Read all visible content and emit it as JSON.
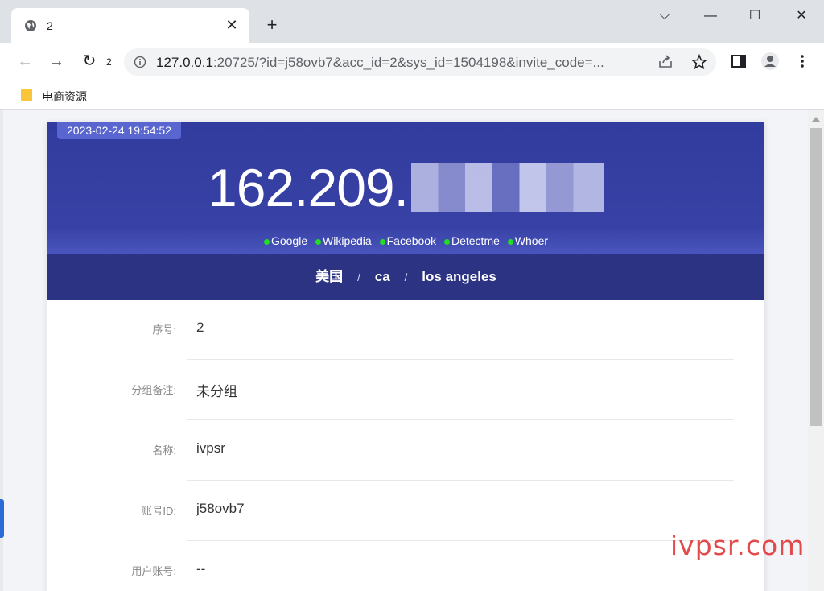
{
  "browser": {
    "tab_title": "2",
    "reload_count": "2",
    "url_host": "127.0.0.1",
    "url_rest": ":20725/?id=j58ovb7&acc_id=2&sys_id=1504198&invite_code=...",
    "bookmark_label": "电商资源"
  },
  "hero": {
    "date": "2023-02-24 19:54:52",
    "ip_visible": "162.209.",
    "links": [
      "Google",
      "Wikipedia",
      "Facebook",
      "Detectme",
      "Whoer"
    ],
    "country": "美国",
    "region": "ca",
    "city": "los angeles"
  },
  "rows": [
    {
      "label": "序号:",
      "value": "2"
    },
    {
      "label": "分组备注:",
      "value": "未分组"
    },
    {
      "label": "名称:",
      "value": "ivpsr"
    },
    {
      "label": "账号ID:",
      "value": "j58ovb7"
    },
    {
      "label": "用户账号:",
      "value": "--"
    }
  ],
  "watermark": "ivpsr.com",
  "colors": {
    "hero": "#3842a6",
    "geo_bar": "#2c3382",
    "status_dot": "#22dd22",
    "watermark": "#e14b4b"
  }
}
